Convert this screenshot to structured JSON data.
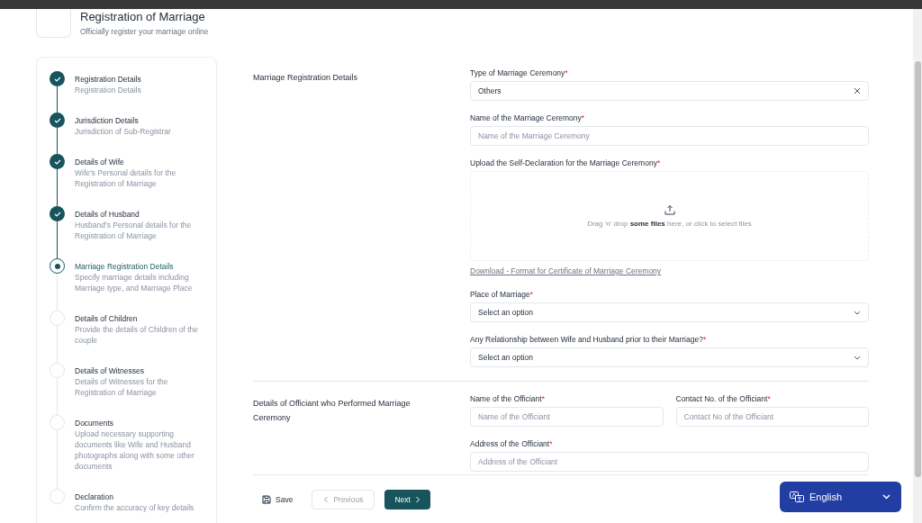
{
  "header": {
    "title": "Registration of Marriage",
    "subtitle": "Officially register your marriage online"
  },
  "steps": [
    {
      "title": "Registration Details",
      "description": "Registration Details",
      "completed": true,
      "selected": false
    },
    {
      "title": "Jurisdiction Details",
      "description": "Jurisdiction of Sub-Registrar",
      "completed": true,
      "selected": false
    },
    {
      "title": "Details of Wife",
      "description": "Wife's Personal details for the Registration of Marriage",
      "completed": true,
      "selected": false
    },
    {
      "title": "Details of Husband",
      "description": "Husband's Personal details for the Registration of Marriage",
      "completed": true,
      "selected": false
    },
    {
      "title": "Marriage Registration Details",
      "description": "Specify marriage details including Marriage type, and Marriage Place",
      "completed": false,
      "selected": true
    },
    {
      "title": "Details of Children",
      "description": "Provide the details of Children of the couple",
      "completed": false,
      "selected": false
    },
    {
      "title": "Details of Witnesses",
      "description": "Details of Witnesses for the Registration of Marriage",
      "completed": false,
      "selected": false
    },
    {
      "title": "Documents",
      "description": "Upload necessary supporting documents like Wife and Husband photographs along with some other documents",
      "completed": false,
      "selected": false
    },
    {
      "title": "Declaration",
      "description": "Confirm the accuracy of key details",
      "completed": false,
      "selected": false
    }
  ],
  "sections": [
    {
      "title": "Marriage Registration Details",
      "rows": [
        [
          {
            "kind": "select",
            "label": "Type of Marriage Ceremony",
            "required_mark": "*",
            "value": "Others",
            "clearable": true
          }
        ],
        [
          {
            "kind": "text",
            "label": "Name of the Marriage Ceremony",
            "required_mark": "*",
            "placeholder": "Name of the Marriage Ceremony"
          }
        ],
        [
          {
            "kind": "upload",
            "label": "Upload the Self-Declaration for the Marriage Ceremony",
            "required_mark": "*",
            "hint": "Drag 'n' drop **some files** here, or click to select files",
            "link": "Download - Format for Certificate of Marriage Ceremony"
          }
        ],
        [
          {
            "kind": "select",
            "label": "Place of Marriage",
            "required_mark": "*",
            "value": "Select an option",
            "clearable": false
          }
        ],
        [
          {
            "kind": "select",
            "label": "Any Relationship between Wife and Husband prior to their Marriage?",
            "required_mark": "*",
            "value": "Select an option",
            "clearable": false
          }
        ]
      ]
    },
    {
      "title": "Details of Officiant who Performed Marriage Ceremony",
      "rows": [
        [
          {
            "kind": "text",
            "label": "Name of the Officiant",
            "required_mark": "*",
            "placeholder": "Name of the Officiant"
          },
          {
            "kind": "text",
            "label": "Contact No. of the Officiant",
            "required_mark": "*",
            "placeholder": "Contact No of the Officiant"
          }
        ],
        [
          {
            "kind": "text",
            "label": "Address of the Officiant",
            "required_mark": "*",
            "placeholder": "Address of the Officiant"
          }
        ]
      ]
    }
  ],
  "footer": {
    "save": {
      "label": "Save"
    },
    "previous": {
      "label": "Previous",
      "disabled": true
    },
    "next": {
      "label": "Next"
    }
  },
  "language": {
    "label": "English"
  }
}
